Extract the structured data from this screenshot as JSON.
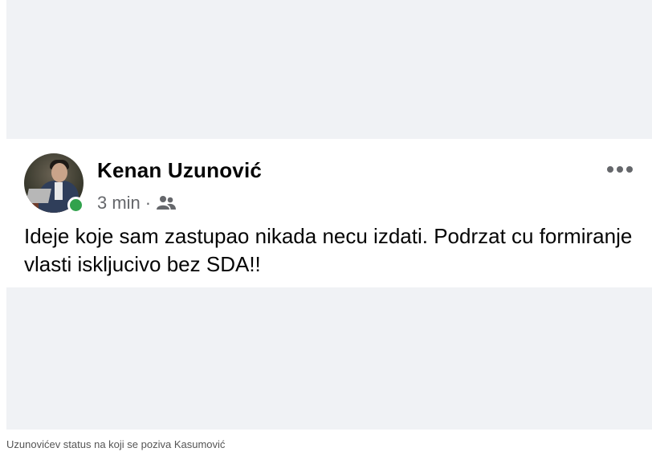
{
  "post": {
    "author": "Kenan Uzunović",
    "time": "3 min",
    "separator": "·",
    "audience_icon": "friends-icon",
    "online_status": "online",
    "text": "Ideje koje sam zastupao nikada necu izdati. Podrzat cu formiranje vlasti iskljucivo bez SDA!!",
    "more_icon": "more-horizontal-icon"
  },
  "caption": "Uzunovićev status na koji se poziva Kasumović",
  "colors": {
    "background": "#f0f2f5",
    "card": "#ffffff",
    "text_primary": "#050505",
    "text_secondary": "#65676b",
    "online": "#31a24c"
  }
}
